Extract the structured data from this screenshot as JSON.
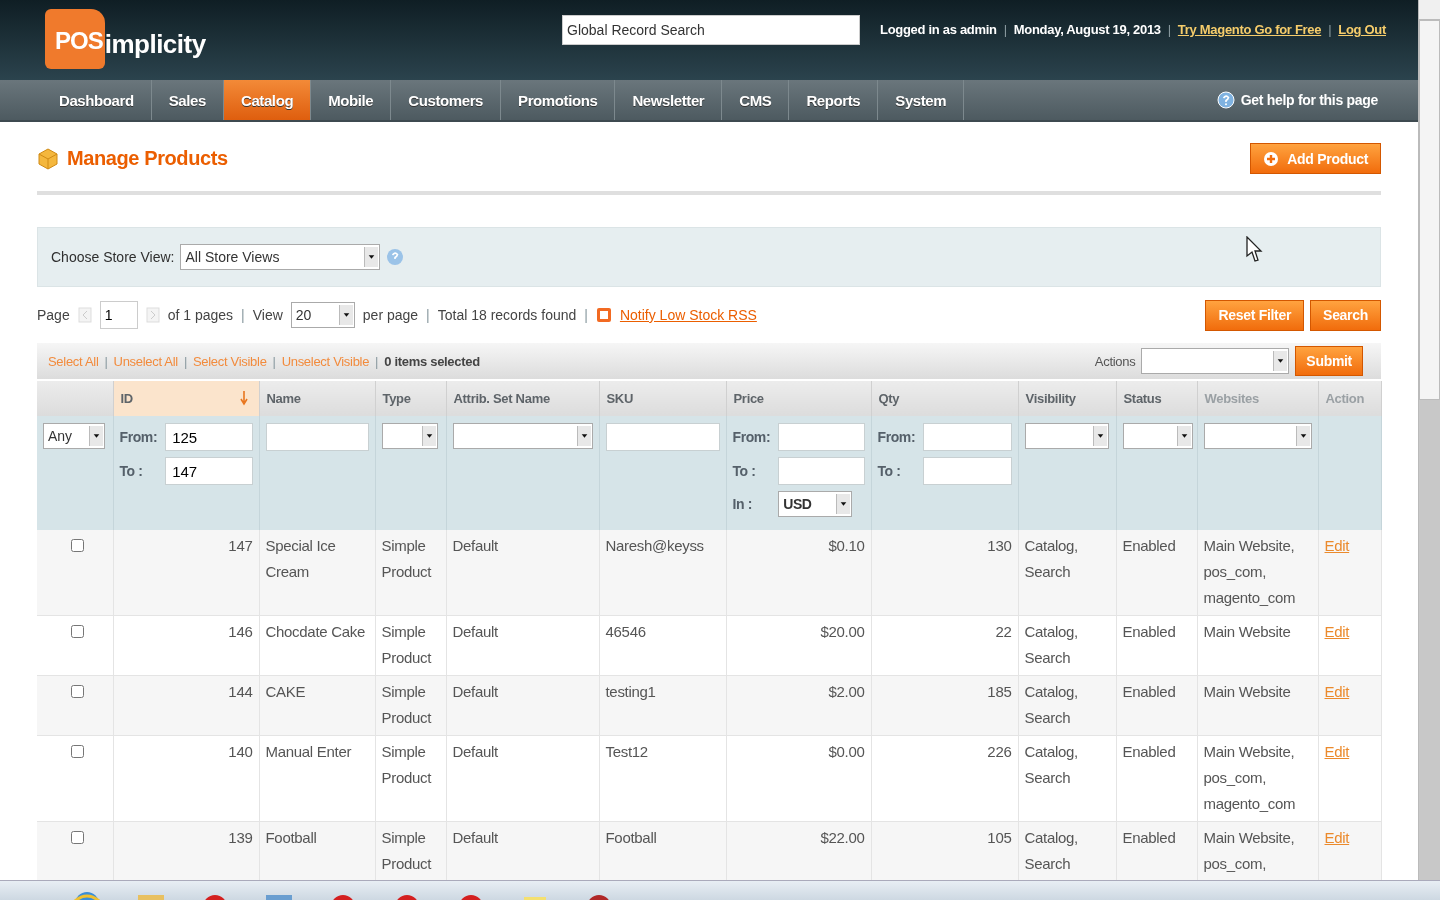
{
  "separator": "|",
  "header": {
    "logo": {
      "badge": "POS",
      "text": "implicity"
    },
    "search": {
      "value": "Global Record Search"
    },
    "user_info": "Logged in as admin",
    "date": "Monday, August 19, 2013",
    "links": [
      "Try Magento Go for Free",
      "Log Out"
    ]
  },
  "nav": {
    "items": [
      {
        "label": "Dashboard",
        "selected": false
      },
      {
        "label": "Sales",
        "selected": false
      },
      {
        "label": "Catalog",
        "selected": true
      },
      {
        "label": "Mobile",
        "selected": false
      },
      {
        "label": "Customers",
        "selected": false
      },
      {
        "label": "Promotions",
        "selected": false
      },
      {
        "label": "Newsletter",
        "selected": false
      },
      {
        "label": "CMS",
        "selected": false
      },
      {
        "label": "Reports",
        "selected": false
      },
      {
        "label": "System",
        "selected": false
      }
    ],
    "help": "Get help for this page"
  },
  "page": {
    "title": "Manage Products",
    "add_button": "Add Product"
  },
  "store_view": {
    "label": "Choose Store View:",
    "value": "All Store Views"
  },
  "pager": {
    "page_label": "Page",
    "page": "1",
    "of_pages": "of 1 pages",
    "view_label": "View",
    "per_page": "20",
    "per_page_label": "per page",
    "total": "Total 18 records found",
    "rss_link": "Notify Low Stock RSS",
    "buttons": [
      "Reset Filter",
      "Search"
    ]
  },
  "massaction": {
    "links": [
      "Select All",
      "Unselect All",
      "Select Visible",
      "Unselect Visible"
    ],
    "count": "0 items selected",
    "actions_label": "Actions",
    "submit": "Submit"
  },
  "table": {
    "columns": [
      {
        "label": "ID",
        "sorted": true,
        "muted": false
      },
      {
        "label": "Name",
        "sorted": false,
        "muted": false
      },
      {
        "label": "Type",
        "sorted": false,
        "muted": false
      },
      {
        "label": "Attrib. Set Name",
        "sorted": false,
        "muted": false
      },
      {
        "label": "SKU",
        "sorted": false,
        "muted": false
      },
      {
        "label": "Price",
        "sorted": false,
        "muted": false
      },
      {
        "label": "Qty",
        "sorted": false,
        "muted": false
      },
      {
        "label": "Visibility",
        "sorted": false,
        "muted": false
      },
      {
        "label": "Status",
        "sorted": false,
        "muted": false
      },
      {
        "label": "Websites",
        "sorted": false,
        "muted": true
      },
      {
        "label": "Action",
        "sorted": false,
        "muted": true
      }
    ],
    "filters": [
      {
        "kind": "select",
        "value": "Any"
      },
      {
        "kind": "range",
        "from_label": "From:",
        "from": "125",
        "to_label": "To :",
        "to": "147"
      },
      {
        "kind": "text"
      },
      {
        "kind": "select"
      },
      {
        "kind": "select"
      },
      {
        "kind": "text"
      },
      {
        "kind": "range",
        "from_label": "From:",
        "to_label": "To :",
        "currency_label": "In :",
        "currency": "USD"
      },
      {
        "kind": "range",
        "from_label": "From:",
        "to_label": "To :"
      },
      {
        "kind": "select"
      },
      {
        "kind": "select"
      },
      {
        "kind": "select"
      },
      {
        "kind": "none"
      }
    ],
    "rows": [
      {
        "checked": false,
        "id": "147",
        "name": "Special Ice Cream",
        "type": "Simple Product",
        "attrib_set": "Default",
        "sku": "Naresh@keyss",
        "price": "$0.10",
        "qty": "130",
        "visibility": "Catalog, Search",
        "status": "Enabled",
        "websites": "Main Website, pos_com, magento_com",
        "action": "Edit"
      },
      {
        "checked": false,
        "id": "146",
        "name": "Chocdate Cake",
        "type": "Simple Product",
        "attrib_set": "Default",
        "sku": "46546",
        "price": "$20.00",
        "qty": "22",
        "visibility": "Catalog, Search",
        "status": "Enabled",
        "websites": "Main Website",
        "action": "Edit"
      },
      {
        "checked": false,
        "id": "144",
        "name": "CAKE",
        "type": "Simple Product",
        "attrib_set": "Default",
        "sku": "testing1",
        "price": "$2.00",
        "qty": "185",
        "visibility": "Catalog, Search",
        "status": "Enabled",
        "websites": "Main Website",
        "action": "Edit"
      },
      {
        "checked": false,
        "id": "140",
        "name": "Manual Enter",
        "type": "Simple Product",
        "attrib_set": "Default",
        "sku": "Test12",
        "price": "$0.00",
        "qty": "226",
        "visibility": "Catalog, Search",
        "status": "Enabled",
        "websites": "Main Website, pos_com, magento_com",
        "action": "Edit"
      },
      {
        "checked": false,
        "id": "139",
        "name": "Football",
        "type": "Simple Product",
        "attrib_set": "Default",
        "sku": "Football",
        "price": "$22.00",
        "qty": "105",
        "visibility": "Catalog, Search",
        "status": "Enabled",
        "websites": "Main Website, pos_com,",
        "action": "Edit"
      }
    ]
  }
}
